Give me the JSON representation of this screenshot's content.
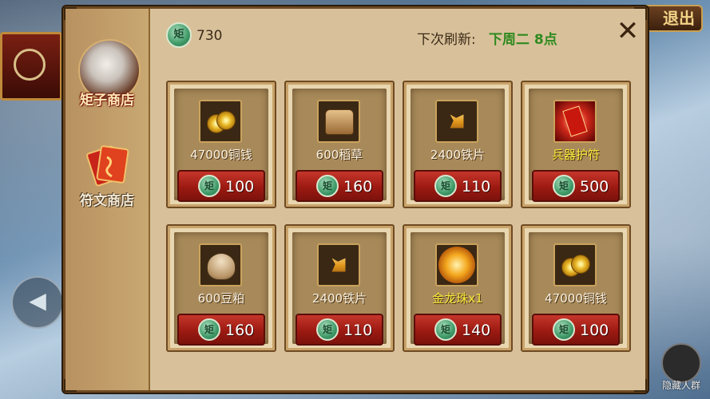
{
  "background": {
    "exit_button_label": "退出",
    "hide_label": "隐藏人群",
    "left_arrow_icon": "left-arrow-icon"
  },
  "sidebar": {
    "items": [
      {
        "label": "矩子商店",
        "active": true,
        "icon": "portrait-icon"
      },
      {
        "label": "符文商店",
        "active": false,
        "icon": "scroll-icon"
      }
    ]
  },
  "header": {
    "currency_symbol": "矩",
    "currency_amount": "730",
    "refresh_label": "下次刷新:",
    "refresh_time": "下周二 8点",
    "close_icon": "close-icon"
  },
  "items": [
    {
      "name": "47000铜钱",
      "price": "100",
      "rare": false,
      "icon": "copper-coins-icon"
    },
    {
      "name": "600稻草",
      "price": "160",
      "rare": false,
      "icon": "straw-bale-icon"
    },
    {
      "name": "2400铁片",
      "price": "110",
      "rare": false,
      "icon": "iron-shards-icon"
    },
    {
      "name": "兵器护符",
      "price": "500",
      "rare": true,
      "icon": "weapon-talisman-icon"
    },
    {
      "name": "600豆粕",
      "price": "160",
      "rare": false,
      "icon": "bean-sack-icon"
    },
    {
      "name": "2400铁片",
      "price": "110",
      "rare": false,
      "icon": "iron-shards-icon"
    },
    {
      "name": "金龙珠x1",
      "price": "140",
      "rare": true,
      "icon": "golden-dragon-pearl-icon"
    },
    {
      "name": "47000铜钱",
      "price": "100",
      "rare": false,
      "icon": "copper-coins-icon"
    }
  ],
  "colors": {
    "rare_name": "#f7ea3a",
    "refresh_time": "#2f8a1f",
    "buy_button": "#b0241a"
  }
}
